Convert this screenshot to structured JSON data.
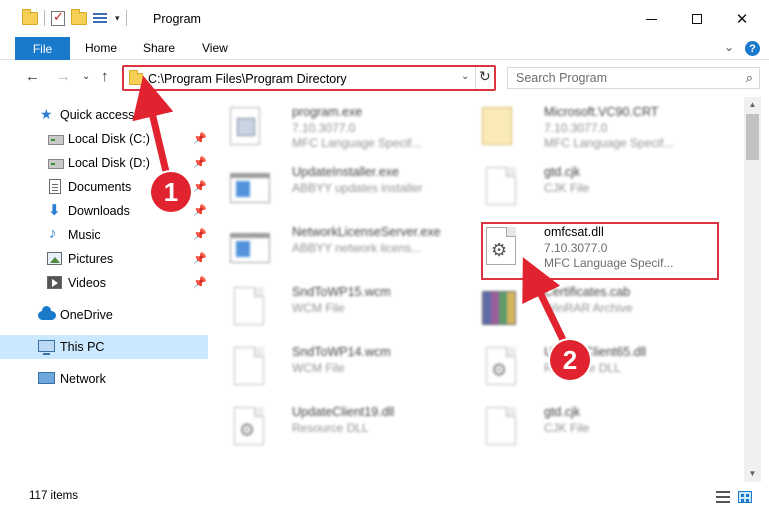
{
  "window": {
    "title": "Program",
    "controls": {
      "minimize": "—",
      "maximize": "",
      "close": "✕"
    }
  },
  "ribbon": {
    "tabs": [
      "File",
      "Home",
      "Share",
      "View"
    ],
    "expand_glyph": "⌄",
    "help_glyph": "?"
  },
  "nav": {
    "back_glyph": "←",
    "forward_glyph": "→",
    "recent_glyph": "⌄",
    "up_glyph": "↑",
    "address": "C:\\Program Files\\Program Directory",
    "address_dropdown": "⌄",
    "refresh_glyph": "↻",
    "search_placeholder": "Search Program",
    "search_glyph": "⌕"
  },
  "sidebar": {
    "items": [
      {
        "label": "Quick access",
        "icon": "star-icon",
        "pinned": false
      },
      {
        "label": "Local Disk (C:)",
        "icon": "drive-icon",
        "pinned": true
      },
      {
        "label": "Local Disk (D:)",
        "icon": "drive-icon",
        "pinned": true
      },
      {
        "label": "Documents",
        "icon": "documents-icon",
        "pinned": true
      },
      {
        "label": "Downloads",
        "icon": "downloads-icon",
        "pinned": true
      },
      {
        "label": "Music",
        "icon": "music-icon",
        "pinned": true
      },
      {
        "label": "Pictures",
        "icon": "pictures-icon",
        "pinned": true
      },
      {
        "label": "Videos",
        "icon": "videos-icon",
        "pinned": true
      },
      {
        "label": "OneDrive",
        "icon": "onedrive-icon",
        "pinned": false
      },
      {
        "label": "This PC",
        "icon": "this-pc-icon",
        "pinned": false,
        "selected": true
      },
      {
        "label": "Network",
        "icon": "network-icon",
        "pinned": false
      }
    ],
    "pin_glyph": "📌"
  },
  "files": [
    {
      "name": "program.exe",
      "line1": "7.10.3077.0",
      "line2": "MFC Language Specif...",
      "icon": "exe-icon"
    },
    {
      "name": "Microsoft.VC90.CRT",
      "line1": "7.10.3077.0",
      "line2": "MFC Language Specif...",
      "icon": "manifest-icon"
    },
    {
      "name": "UpdateInstaller.exe",
      "line1": "ABBYY updates installer",
      "line2": "",
      "icon": "window-icon"
    },
    {
      "name": "gtd.cjk",
      "line1": "CJK File",
      "line2": "",
      "icon": "page-icon"
    },
    {
      "name": "NetworkLicenseServer.exe",
      "line1": "ABBYY network licens...",
      "line2": "",
      "icon": "window-icon"
    },
    {
      "name": "omfcsat.dll",
      "line1": "7.10.3077.0",
      "line2": "MFC Language Specif...",
      "icon": "dll-gear-icon"
    },
    {
      "name": "SndToWP15.wcm",
      "line1": "WCM File",
      "line2": "",
      "icon": "page-icon"
    },
    {
      "name": "Certificates.cab",
      "line1": "WinRAR Archive",
      "line2": "",
      "icon": "rar-icon"
    },
    {
      "name": "SndToWP14.wcm",
      "line1": "WCM File",
      "line2": "",
      "icon": "page-icon"
    },
    {
      "name": "UpdateClient65.dll",
      "line1": "Resource DLL",
      "line2": "",
      "icon": "dll-gear-icon"
    },
    {
      "name": "UpdateClient19.dll",
      "line1": "Resource DLL",
      "line2": "",
      "icon": "dll-gear-icon"
    },
    {
      "name": "gtd.cjk",
      "line1": "CJK File",
      "line2": "",
      "icon": "page-icon"
    }
  ],
  "status": {
    "item_count": "117 items"
  },
  "annotations": {
    "step1": "1",
    "step2": "2",
    "color": "#e0232e"
  }
}
